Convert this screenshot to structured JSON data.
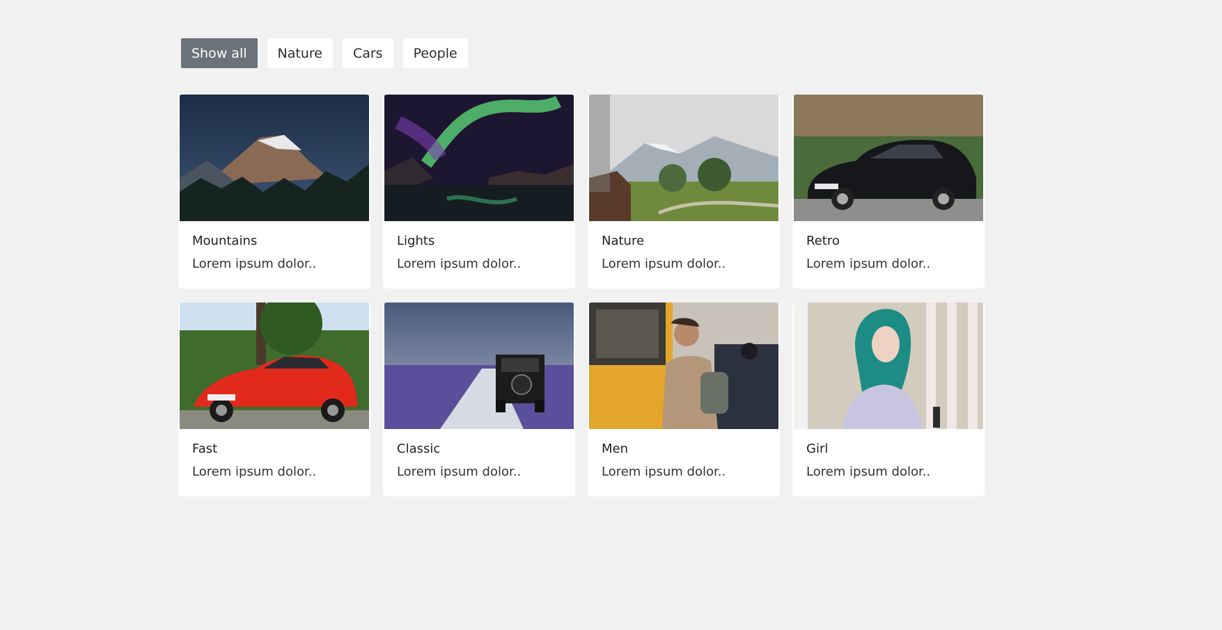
{
  "filters": [
    {
      "label": "Show all",
      "active": true
    },
    {
      "label": "Nature",
      "active": false
    },
    {
      "label": "Cars",
      "active": false
    },
    {
      "label": "People",
      "active": false
    }
  ],
  "cards": [
    {
      "title": "Mountains",
      "text": "Lorem ipsum dolor..",
      "image": "mountain-night-photo"
    },
    {
      "title": "Lights",
      "text": "Lorem ipsum dolor..",
      "image": "aurora-lights-photo"
    },
    {
      "title": "Nature",
      "text": "Lorem ipsum dolor..",
      "image": "alpine-valley-photo"
    },
    {
      "title": "Retro",
      "text": "Lorem ipsum dolor..",
      "image": "black-hatchback-photo"
    },
    {
      "title": "Fast",
      "text": "Lorem ipsum dolor..",
      "image": "red-sports-car-photo"
    },
    {
      "title": "Classic",
      "text": "Lorem ipsum dolor..",
      "image": "offroad-jeep-photo"
    },
    {
      "title": "Men",
      "text": "Lorem ipsum dolor..",
      "image": "man-by-train-photo"
    },
    {
      "title": "Girl",
      "text": "Lorem ipsum dolor..",
      "image": "girl-portrait-photo"
    }
  ]
}
